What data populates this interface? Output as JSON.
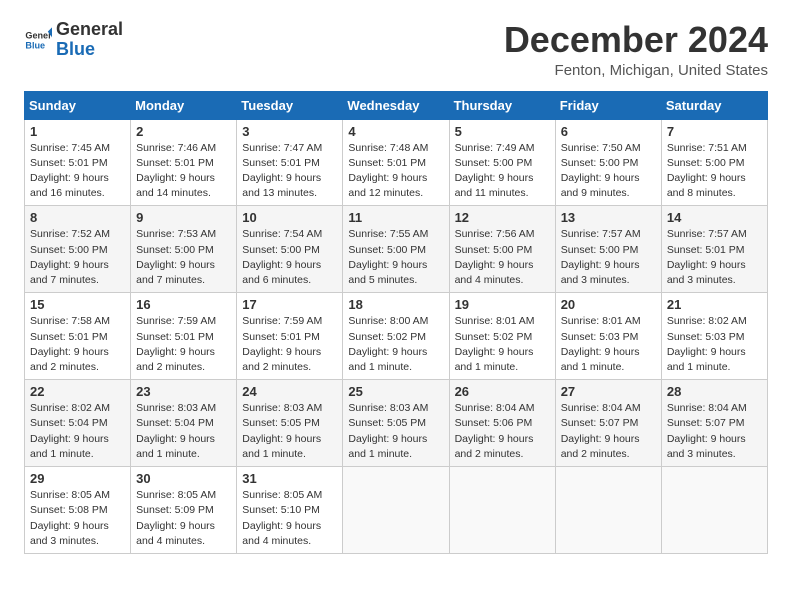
{
  "logo": {
    "general": "General",
    "blue": "Blue"
  },
  "header": {
    "title": "December 2024",
    "location": "Fenton, Michigan, United States"
  },
  "weekdays": [
    "Sunday",
    "Monday",
    "Tuesday",
    "Wednesday",
    "Thursday",
    "Friday",
    "Saturday"
  ],
  "weeks": [
    [
      {
        "day": "1",
        "info": "Sunrise: 7:45 AM\nSunset: 5:01 PM\nDaylight: 9 hours and 16 minutes."
      },
      {
        "day": "2",
        "info": "Sunrise: 7:46 AM\nSunset: 5:01 PM\nDaylight: 9 hours and 14 minutes."
      },
      {
        "day": "3",
        "info": "Sunrise: 7:47 AM\nSunset: 5:01 PM\nDaylight: 9 hours and 13 minutes."
      },
      {
        "day": "4",
        "info": "Sunrise: 7:48 AM\nSunset: 5:01 PM\nDaylight: 9 hours and 12 minutes."
      },
      {
        "day": "5",
        "info": "Sunrise: 7:49 AM\nSunset: 5:00 PM\nDaylight: 9 hours and 11 minutes."
      },
      {
        "day": "6",
        "info": "Sunrise: 7:50 AM\nSunset: 5:00 PM\nDaylight: 9 hours and 9 minutes."
      },
      {
        "day": "7",
        "info": "Sunrise: 7:51 AM\nSunset: 5:00 PM\nDaylight: 9 hours and 8 minutes."
      }
    ],
    [
      {
        "day": "8",
        "info": "Sunrise: 7:52 AM\nSunset: 5:00 PM\nDaylight: 9 hours and 7 minutes."
      },
      {
        "day": "9",
        "info": "Sunrise: 7:53 AM\nSunset: 5:00 PM\nDaylight: 9 hours and 7 minutes."
      },
      {
        "day": "10",
        "info": "Sunrise: 7:54 AM\nSunset: 5:00 PM\nDaylight: 9 hours and 6 minutes."
      },
      {
        "day": "11",
        "info": "Sunrise: 7:55 AM\nSunset: 5:00 PM\nDaylight: 9 hours and 5 minutes."
      },
      {
        "day": "12",
        "info": "Sunrise: 7:56 AM\nSunset: 5:00 PM\nDaylight: 9 hours and 4 minutes."
      },
      {
        "day": "13",
        "info": "Sunrise: 7:57 AM\nSunset: 5:00 PM\nDaylight: 9 hours and 3 minutes."
      },
      {
        "day": "14",
        "info": "Sunrise: 7:57 AM\nSunset: 5:01 PM\nDaylight: 9 hours and 3 minutes."
      }
    ],
    [
      {
        "day": "15",
        "info": "Sunrise: 7:58 AM\nSunset: 5:01 PM\nDaylight: 9 hours and 2 minutes."
      },
      {
        "day": "16",
        "info": "Sunrise: 7:59 AM\nSunset: 5:01 PM\nDaylight: 9 hours and 2 minutes."
      },
      {
        "day": "17",
        "info": "Sunrise: 7:59 AM\nSunset: 5:01 PM\nDaylight: 9 hours and 2 minutes."
      },
      {
        "day": "18",
        "info": "Sunrise: 8:00 AM\nSunset: 5:02 PM\nDaylight: 9 hours and 1 minute."
      },
      {
        "day": "19",
        "info": "Sunrise: 8:01 AM\nSunset: 5:02 PM\nDaylight: 9 hours and 1 minute."
      },
      {
        "day": "20",
        "info": "Sunrise: 8:01 AM\nSunset: 5:03 PM\nDaylight: 9 hours and 1 minute."
      },
      {
        "day": "21",
        "info": "Sunrise: 8:02 AM\nSunset: 5:03 PM\nDaylight: 9 hours and 1 minute."
      }
    ],
    [
      {
        "day": "22",
        "info": "Sunrise: 8:02 AM\nSunset: 5:04 PM\nDaylight: 9 hours and 1 minute."
      },
      {
        "day": "23",
        "info": "Sunrise: 8:03 AM\nSunset: 5:04 PM\nDaylight: 9 hours and 1 minute."
      },
      {
        "day": "24",
        "info": "Sunrise: 8:03 AM\nSunset: 5:05 PM\nDaylight: 9 hours and 1 minute."
      },
      {
        "day": "25",
        "info": "Sunrise: 8:03 AM\nSunset: 5:05 PM\nDaylight: 9 hours and 1 minute."
      },
      {
        "day": "26",
        "info": "Sunrise: 8:04 AM\nSunset: 5:06 PM\nDaylight: 9 hours and 2 minutes."
      },
      {
        "day": "27",
        "info": "Sunrise: 8:04 AM\nSunset: 5:07 PM\nDaylight: 9 hours and 2 minutes."
      },
      {
        "day": "28",
        "info": "Sunrise: 8:04 AM\nSunset: 5:07 PM\nDaylight: 9 hours and 3 minutes."
      }
    ],
    [
      {
        "day": "29",
        "info": "Sunrise: 8:05 AM\nSunset: 5:08 PM\nDaylight: 9 hours and 3 minutes."
      },
      {
        "day": "30",
        "info": "Sunrise: 8:05 AM\nSunset: 5:09 PM\nDaylight: 9 hours and 4 minutes."
      },
      {
        "day": "31",
        "info": "Sunrise: 8:05 AM\nSunset: 5:10 PM\nDaylight: 9 hours and 4 minutes."
      },
      null,
      null,
      null,
      null
    ]
  ]
}
